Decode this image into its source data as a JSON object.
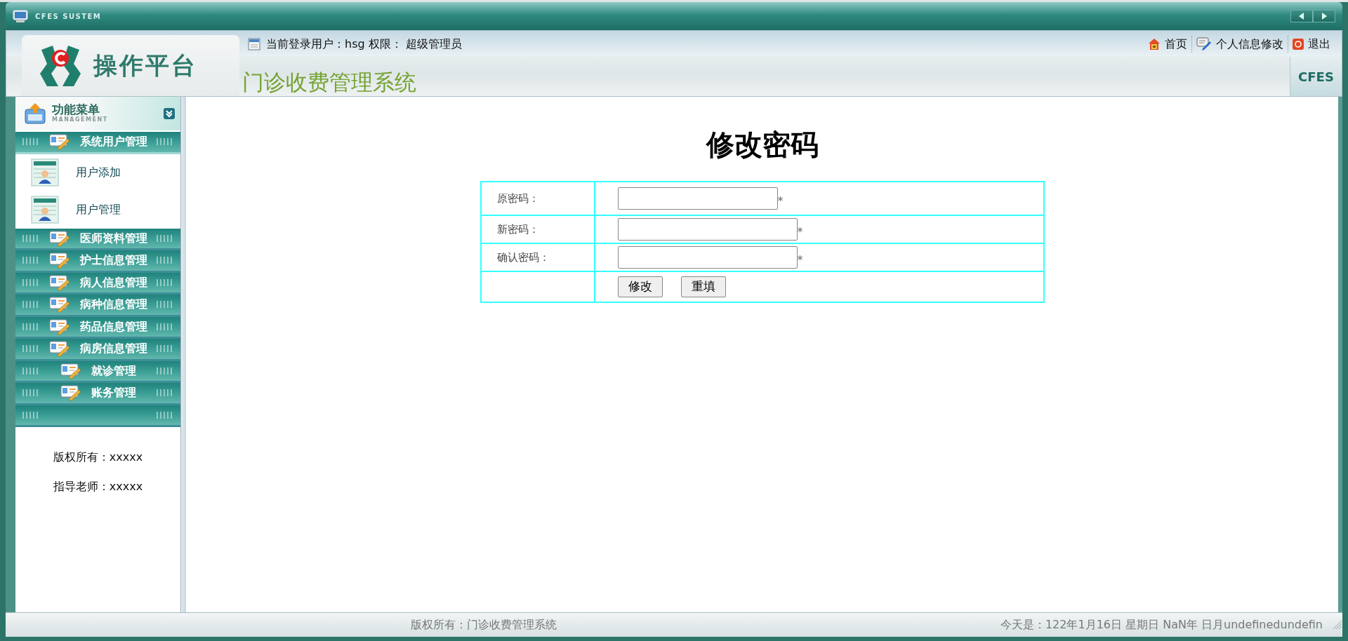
{
  "window": {
    "title": "CFES SUSTEM"
  },
  "header": {
    "logo_text": "操作平台",
    "system_title": "门诊收费管理系统",
    "user_info": "当前登录用户：hsg 权限： 超级管理员",
    "badge": "CFES",
    "links": [
      {
        "label": "首页",
        "kind": "home"
      },
      {
        "label": "个人信息修改",
        "kind": "edit"
      },
      {
        "label": "退出",
        "kind": "exit"
      }
    ]
  },
  "sidebar": {
    "title": "功能菜单",
    "subtitle": "MANAGEMENT",
    "groups": [
      {
        "label": "系统用户管理",
        "expanded": true,
        "items": [
          {
            "label": "用户添加"
          },
          {
            "label": "用户管理"
          }
        ]
      },
      {
        "label": "医师资料管理",
        "expanded": false
      },
      {
        "label": "护士信息管理",
        "expanded": false
      },
      {
        "label": "病人信息管理",
        "expanded": false
      },
      {
        "label": "病种信息管理",
        "expanded": false
      },
      {
        "label": "药品信息管理",
        "expanded": false
      },
      {
        "label": "病房信息管理",
        "expanded": false
      },
      {
        "label": "就诊管理",
        "expanded": false
      },
      {
        "label": "账务管理",
        "expanded": false
      }
    ],
    "footer": [
      "版权所有：xxxxx",
      "指导老师：xxxxx"
    ]
  },
  "form": {
    "title": "修改密码",
    "fields": [
      {
        "label": "原密码：",
        "required_mark": "*"
      },
      {
        "label": "新密码：",
        "required_mark": "*"
      },
      {
        "label": "确认密码：",
        "required_mark": "*"
      }
    ],
    "buttons": [
      "修改",
      "重填"
    ]
  },
  "status_bar": {
    "left": "版权所有：门诊收费管理系统",
    "right": "今天是：122年1月16日 星期日 NaN年 日月undefinedundefin"
  }
}
